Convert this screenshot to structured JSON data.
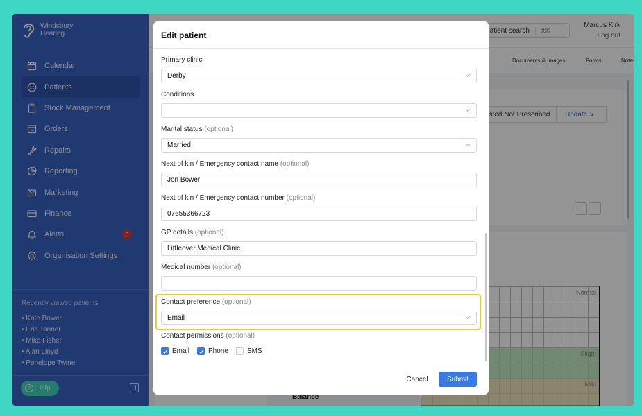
{
  "brand": {
    "line1": "Windsbury",
    "line2": "Hearing"
  },
  "sidebar": {
    "items": [
      {
        "label": "Calendar",
        "icon": "calendar-icon"
      },
      {
        "label": "Patients",
        "icon": "smile-icon"
      },
      {
        "label": "Stock Management",
        "icon": "clipboard-icon"
      },
      {
        "label": "Orders",
        "icon": "archive-icon"
      },
      {
        "label": "Repairs",
        "icon": "wrench-icon"
      },
      {
        "label": "Reporting",
        "icon": "pie-chart-icon"
      },
      {
        "label": "Marketing",
        "icon": "mail-icon"
      },
      {
        "label": "Finance",
        "icon": "credit-card-icon"
      },
      {
        "label": "Alerts",
        "icon": "bell-icon",
        "badge": "6"
      },
      {
        "label": "Organisation Settings",
        "icon": "gear-icon"
      }
    ],
    "active": "Patients",
    "recent_title": "Recently viewed patients",
    "recent": [
      "• Kate Bower",
      "• Eric Tanner",
      "• Mike Fisher",
      "• Alan Lloyd",
      "• Penelope Twine"
    ],
    "help_label": "Help"
  },
  "topbar": {
    "search_label": "Patient search",
    "search_shortcut": "⌘K",
    "user_name": "Marcus Kirk",
    "logout": "Log out"
  },
  "tabs": [
    "Documents & Images",
    "Forms",
    "Notes"
  ],
  "background": {
    "status_text": "ested Not Prescribed",
    "update_label": "Update ∨",
    "audiogram_labels": [
      "Normal",
      "Slight",
      "Mild"
    ],
    "balance_label": "Balance"
  },
  "modal": {
    "title": "Edit patient",
    "fields": [
      {
        "label": "Primary clinic",
        "optional": "",
        "value": "Derby",
        "select": true
      },
      {
        "label": "Conditions",
        "optional": "",
        "value": "",
        "select": true
      },
      {
        "label": "Marital status",
        "optional": "(optional)",
        "value": "Married",
        "select": true
      },
      {
        "label": "Next of kin / Emergency contact name",
        "optional": "(optional)",
        "value": "Jon Bower",
        "select": false
      },
      {
        "label": "Next of kin / Emergency contact number",
        "optional": "(optional)",
        "value": "07655366723",
        "select": false
      },
      {
        "label": "GP details",
        "optional": "(optional)",
        "value": "Littleover Medical Clinic",
        "select": false
      },
      {
        "label": "Medical number",
        "optional": "(optional)",
        "value": "",
        "select": false
      },
      {
        "label": "Contact preference",
        "optional": "(optional)",
        "value": "Email",
        "select": true
      }
    ],
    "permissions_label": "Contact permissions",
    "permissions_optional": "(optional)",
    "permissions": [
      {
        "label": "Email",
        "checked": true
      },
      {
        "label": "Phone",
        "checked": true
      },
      {
        "label": "SMS",
        "checked": false
      }
    ],
    "cancel_label": "Cancel",
    "submit_label": "Submit",
    "highlight_color": "#f0c92a"
  }
}
